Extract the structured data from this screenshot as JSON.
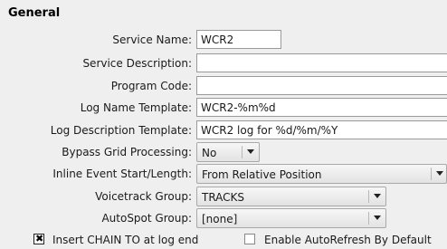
{
  "section": {
    "title": "General"
  },
  "fields": {
    "service_name": {
      "label": "Service Name:",
      "value": "WCR2"
    },
    "service_description": {
      "label": "Service Description:",
      "value": ""
    },
    "program_code": {
      "label": "Program Code:",
      "value": ""
    },
    "log_name_template": {
      "label": "Log Name Template:",
      "value": "WCR2-%m%d"
    },
    "log_description_template": {
      "label": "Log Description Template:",
      "value": "WCR2 log for %d/%m/%Y"
    },
    "bypass_grid_processing": {
      "label": "Bypass Grid Processing:",
      "value": "No"
    },
    "inline_event": {
      "label": "Inline Event Start/Length:",
      "value": "From Relative Position"
    },
    "voicetrack_group": {
      "label": "Voicetrack Group:",
      "value": "TRACKS"
    },
    "autospot_group": {
      "label": "AutoSpot Group:",
      "value": "[none]"
    }
  },
  "checkboxes": {
    "insert_chain": {
      "label": "Insert CHAIN TO at log end",
      "checked": true
    },
    "auto_refresh": {
      "label": "Enable AutoRefresh By Default",
      "checked": false
    }
  },
  "icons": {
    "dropdown": "chevron-down-icon",
    "checkmark": "checkmark-icon"
  }
}
